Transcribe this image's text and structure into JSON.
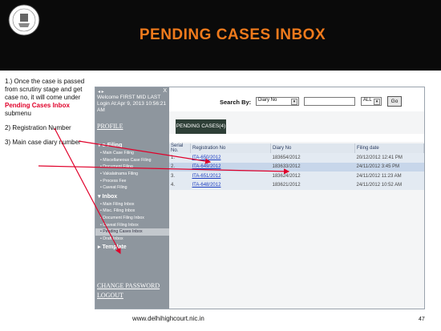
{
  "slide": {
    "title": "PENDING CASES INBOX",
    "footer_url": "www.delhihighcourt.nic.in",
    "page_number": "47",
    "emblem_text": "HIGH COURT OF DELHI"
  },
  "notes": [
    {
      "prefix": "1.) Once the case is passed from scrutiny stage and get case no, it will come under ",
      "highlight": "Pending Cases Inbox",
      "suffix": " submenu"
    },
    {
      "prefix": "2) Registration Number",
      "highlight": "",
      "suffix": ""
    },
    {
      "prefix": "3) Main case diary number",
      "highlight": "",
      "suffix": ""
    }
  ],
  "sidebar": {
    "window_controls": "◂ ▸",
    "close": "X",
    "welcome": "Welcome FIRST MID LAST Login At:Apr 9, 2013 10:56:21 AM",
    "profile": "PROFILE",
    "efiling_heading": "e-Filing",
    "efiling_items": [
      "Main Case Filing",
      "Miscellaneous Case Filing",
      "Document Filing",
      "Vakalatnama Filing",
      "Process Fee",
      "Caveat Filing"
    ],
    "inbox_heading": "Inbox",
    "inbox_items": [
      "Main Filing Inbox",
      "Misc. Filing Inbox",
      "Document Filing Inbox",
      "Caveat Filing Inbox",
      "Pending Cases Inbox",
      "Draft Inbox"
    ],
    "template_heading": "Template",
    "change_password": "CHANGE PASSWORD",
    "logout": "LOGOUT"
  },
  "search": {
    "label": "Search By:",
    "field_select": "Diary No",
    "filter_select": "ALL",
    "go_label": "Go"
  },
  "tab": {
    "label": "PENDING CASES(4)"
  },
  "table": {
    "headers": [
      "Serial No.",
      "Registration No",
      "Diary No",
      "Filing date"
    ],
    "rows": [
      [
        "1.",
        "ITA-650/2012",
        "183654/2012",
        "20/12/2012 12:41 PM"
      ],
      [
        "2.",
        "ITA-649/2012",
        "183633/2012",
        "24/11/2012 3:45 PM"
      ],
      [
        "3.",
        "ITA-651/2012",
        "183624/2012",
        "24/11/2012 11:23 AM"
      ],
      [
        "4.",
        "ITA-648/2012",
        "183621/2012",
        "24/11/2012 10:52 AM"
      ]
    ]
  },
  "colors": {
    "title": "#f07a1c",
    "highlight": "#e0002a",
    "sidebar": "#8e969e",
    "tab": "#2e3f37",
    "arrow": "#e0002a"
  }
}
